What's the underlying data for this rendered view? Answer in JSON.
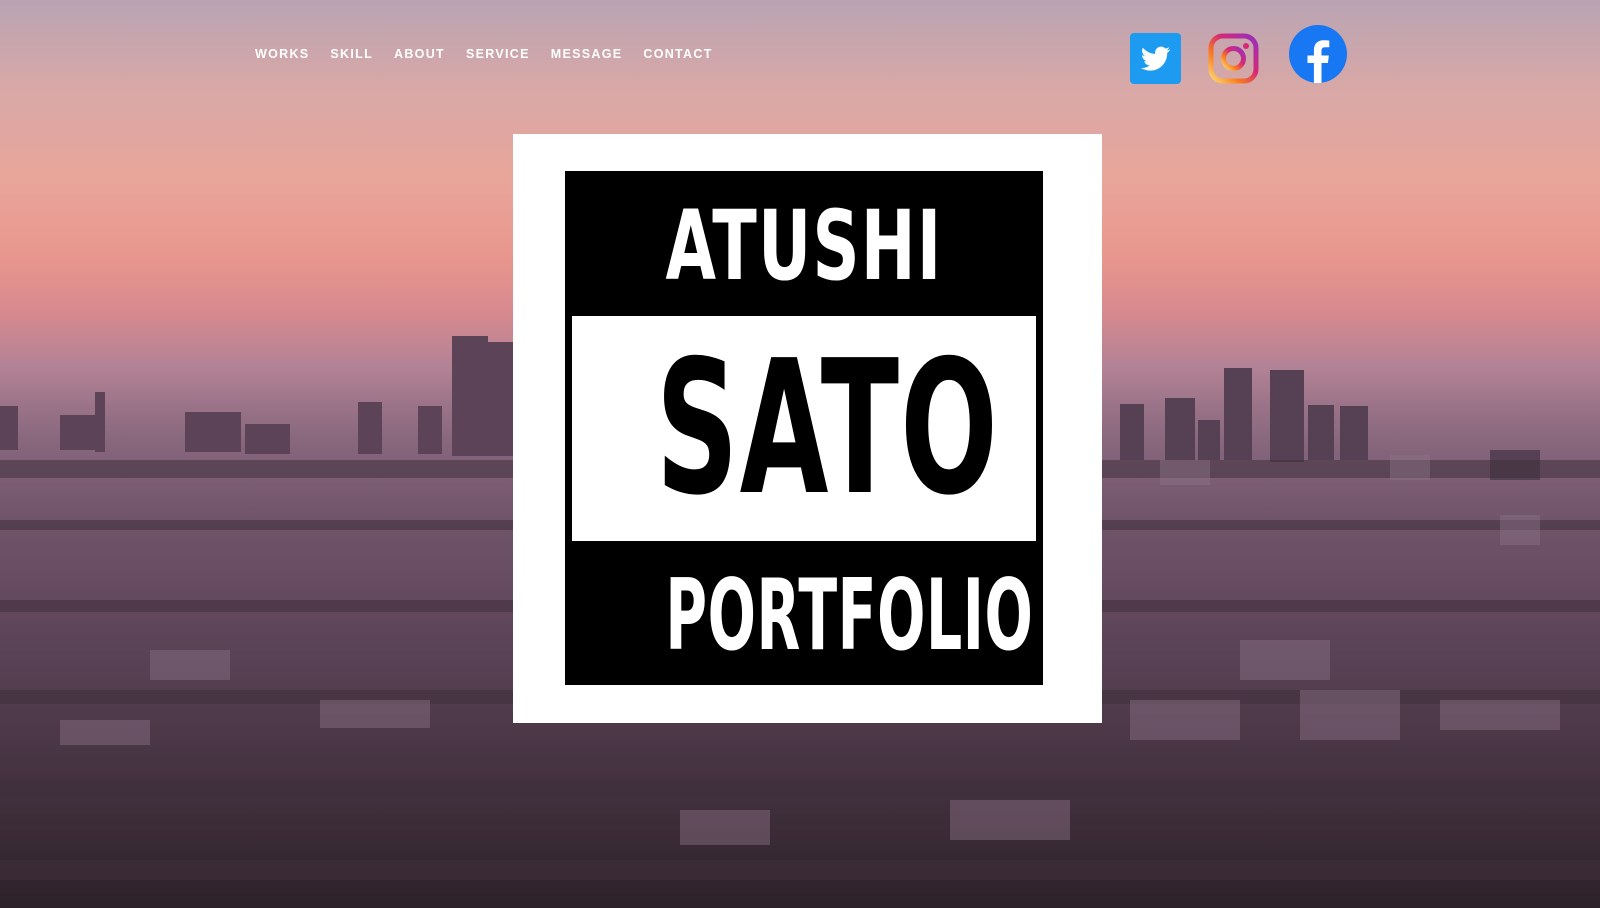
{
  "nav": {
    "items": [
      {
        "label": "WORKS"
      },
      {
        "label": "SKILL"
      },
      {
        "label": "ABOUT"
      },
      {
        "label": "SERVICE"
      },
      {
        "label": "MESSAGE"
      },
      {
        "label": "CONTACT"
      }
    ]
  },
  "social": {
    "icons": [
      "twitter-icon",
      "instagram-icon",
      "facebook-icon"
    ],
    "colors": {
      "twitter": "#1d9bf0",
      "facebook": "#1877f2"
    }
  },
  "logo": {
    "line1": "ATUSHI",
    "line2": "SATO",
    "line3": "PORTFOLIO"
  },
  "colors": {
    "sky_top": "#b9a4b3",
    "sky_glow": "#e9978e",
    "city": "#4f3a4c",
    "nav_text": "#ffffff"
  }
}
